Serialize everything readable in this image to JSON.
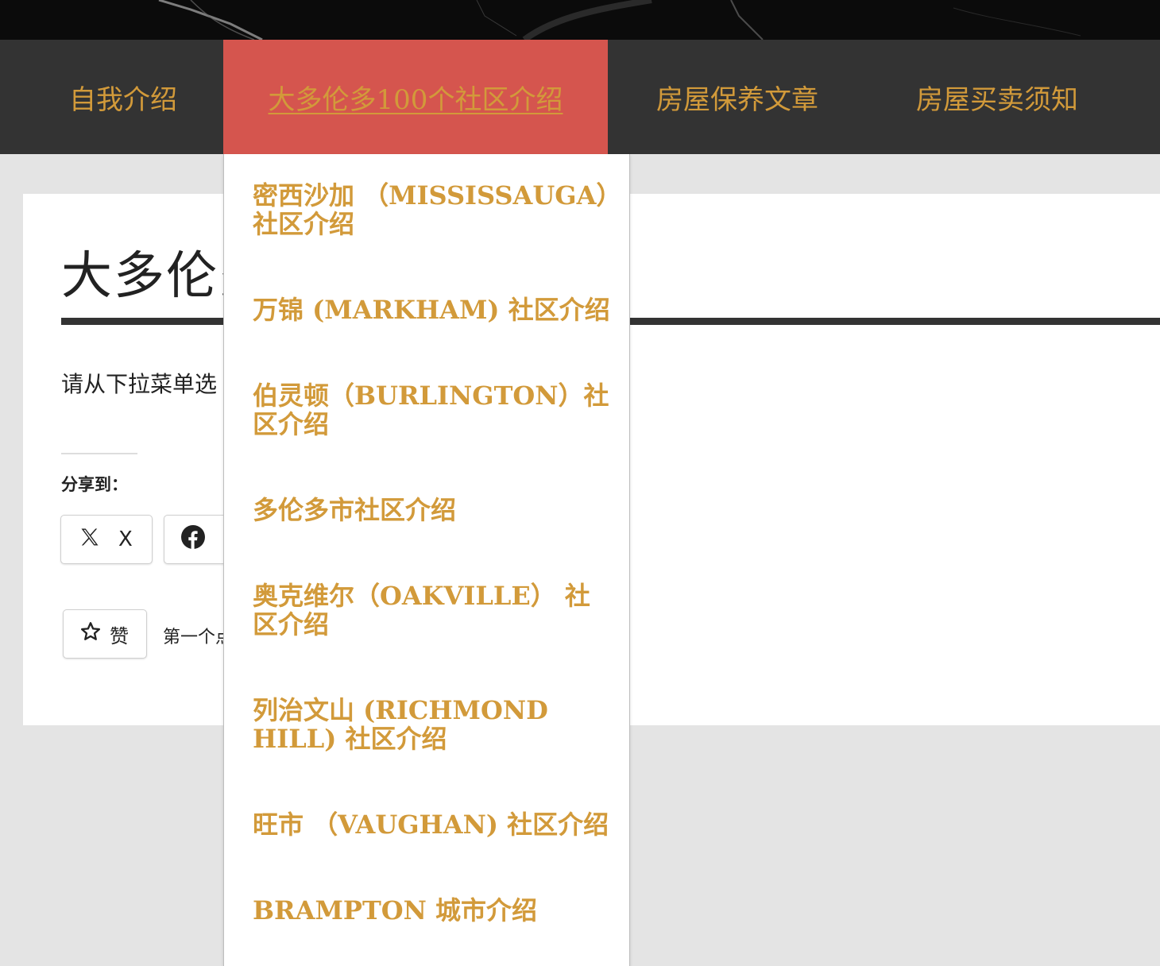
{
  "nav": {
    "items": [
      {
        "label": "自我介绍"
      },
      {
        "label": "大多伦多100个社区介绍"
      },
      {
        "label": "房屋保养文章"
      },
      {
        "label": "房屋买卖须知"
      }
    ],
    "active_index": 1
  },
  "dropdown": {
    "items": [
      {
        "label": "密西沙加 （MISSISSAUGA）社区介绍"
      },
      {
        "label": "万锦 (MARKHAM) 社区介绍"
      },
      {
        "label": "伯灵顿（BURLINGTON）社区介绍"
      },
      {
        "label": "多伦多市社区介绍"
      },
      {
        "label": "奥克维尔（OAKVILLE） 社区介绍"
      },
      {
        "label": "列治文山 (RICHMOND HILL) 社区介绍"
      },
      {
        "label": "旺市 （VAUGHAN) 社区介绍"
      },
      {
        "label": "BRAMPTON 城市介绍"
      }
    ]
  },
  "page": {
    "title": "大多伦多",
    "intro": "请从下拉菜单选"
  },
  "share": {
    "label": "分享到：",
    "x_label": "X",
    "facebook_icon": "facebook-icon",
    "x_icon": "x-logo-icon"
  },
  "like": {
    "label": "赞",
    "note": "第一个点",
    "icon": "star-outline-icon"
  },
  "colors": {
    "nav_bg": "#333333",
    "nav_active_bg": "#d5554e",
    "link_gold": "#d29a3a",
    "page_bg": "#e4e4e4"
  }
}
